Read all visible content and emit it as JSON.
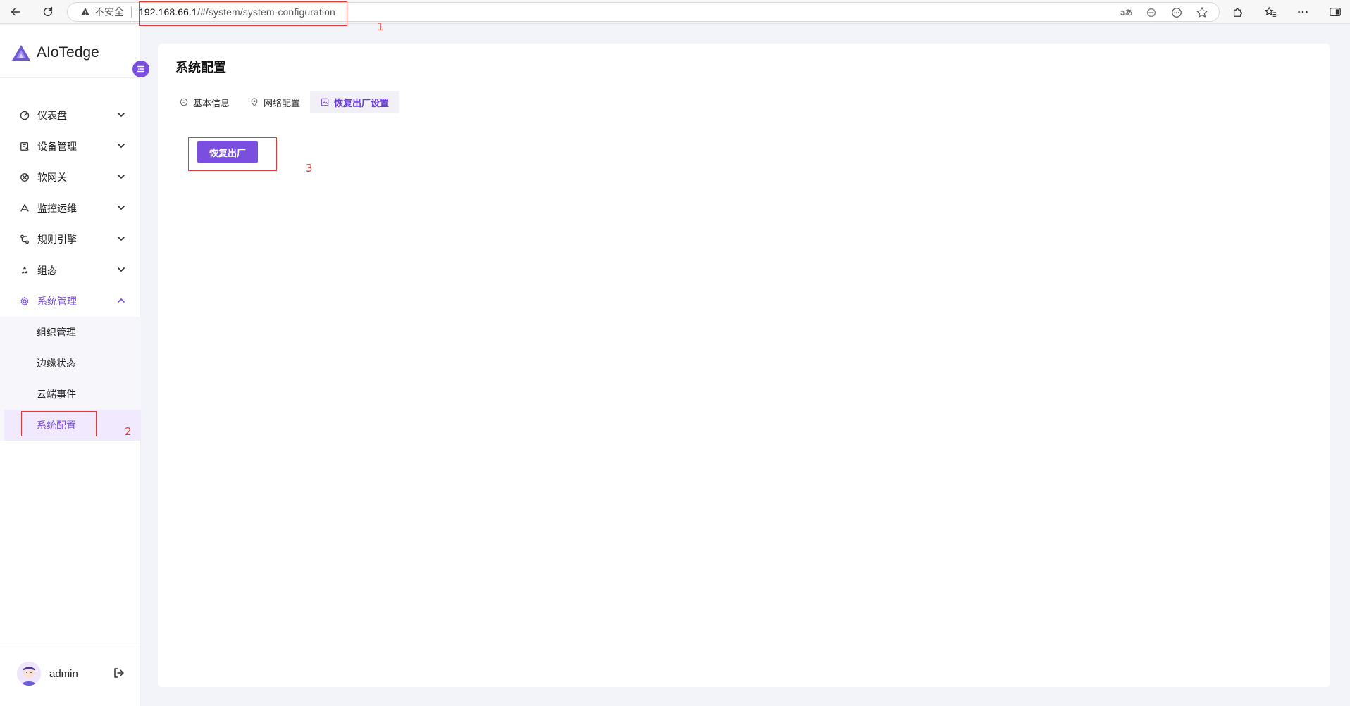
{
  "browser": {
    "security_label": "不安全",
    "url_host": "192.168.66.1",
    "url_path": "/#/system/system-configuration"
  },
  "app": {
    "name": "AIoTedge",
    "accent_color": "#7a4fe0"
  },
  "sidebar": {
    "items": [
      {
        "label": "仪表盘",
        "icon": "dashboard-icon"
      },
      {
        "label": "设备管理",
        "icon": "device-icon"
      },
      {
        "label": "软网关",
        "icon": "gateway-icon"
      },
      {
        "label": "监控运维",
        "icon": "monitor-icon"
      },
      {
        "label": "规则引擎",
        "icon": "rules-icon"
      },
      {
        "label": "组态",
        "icon": "config-icon"
      },
      {
        "label": "系统管理",
        "icon": "gear-icon"
      }
    ],
    "submenu": [
      {
        "label": "组织管理"
      },
      {
        "label": "边缘状态"
      },
      {
        "label": "云端事件"
      },
      {
        "label": "系统配置"
      }
    ],
    "user_name": "admin"
  },
  "main": {
    "title": "系统配置",
    "tabs": [
      {
        "label": "基本信息"
      },
      {
        "label": "网络配置"
      },
      {
        "label": "恢复出厂设置"
      }
    ],
    "reset_button_label": "恢复出厂"
  },
  "annotations": [
    "1",
    "2",
    "3"
  ]
}
